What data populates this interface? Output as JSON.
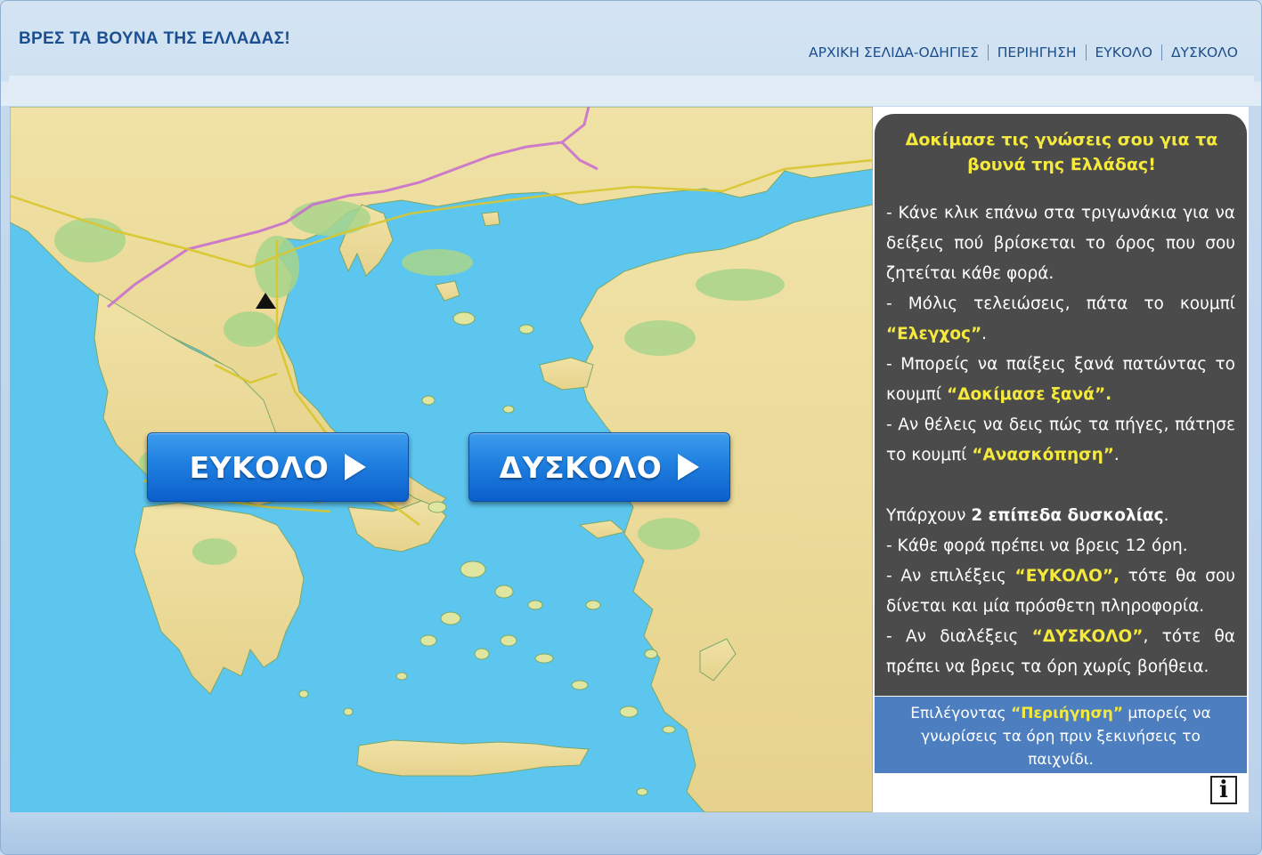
{
  "app": {
    "title": "ΒΡΕΣ ΤΑ ΒΟΥΝΑ ΤΗΣ ΕΛΛΑΔΑΣ!"
  },
  "nav": {
    "items": [
      {
        "label": "ΑΡΧΙΚΗ ΣΕΛΙΔΑ-ΟΔΗΓΙΕΣ"
      },
      {
        "label": "ΠΕΡΙΗΓΗΣΗ"
      },
      {
        "label": "ΕΥΚΟΛΟ"
      },
      {
        "label": "ΔΥΣΚΟΛΟ"
      }
    ]
  },
  "map": {
    "easy_button": {
      "label": "ΕΥΚΟΛΟ",
      "icon": "play-icon"
    },
    "hard_button": {
      "label": "ΔΥΣΚΟΛΟ",
      "icon": "play-icon"
    },
    "marker_icon": "triangle-marker-icon",
    "colors": {
      "sea": "#5cc6ef",
      "land": "#e9dca0",
      "lowland": "#a9d58b",
      "border": "#c56ad0",
      "road": "#d8c52c"
    }
  },
  "panel": {
    "title": "Δοκίμασε τις γνώσεις σου για τα βουνά της Ελλάδας!",
    "line1": "- Κάνε κλικ επάνω στα τριγωνάκια για να δείξεις πού βρίσκεται το όρος που σου ζητείται κάθε φορά.",
    "line2_pre": "- Μόλις τελειώσεις, πάτα το κουμπί ",
    "line2_hl": "“Ελεγχος”",
    "line2_post": ".",
    "line3_pre": "- Μπορείς να παίξεις ξανά πατώντας το κουμπί ",
    "line3_hl": "“Δοκίμασε ξανά”.",
    "line4_pre": "- Αν θέλεις να δεις πώς τα πήγες, πάτησε το κουμπί ",
    "line4_hl": "“Ανασκόπηση”",
    "line4_post": ".",
    "line5_pre": "Υπάρχουν ",
    "line5_bold": "2 επίπεδα δυσκολίας",
    "line5_post": ".",
    "line6": "- Κάθε φορά πρέπει να βρεις 12 όρη.",
    "line7_pre": "- Αν επιλέξεις ",
    "line7_hl": "“ΕΥΚΟΛΟ”,",
    "line7_post": " τότε θα σου δίνεται και μία πρόσθετη πληροφορία.",
    "line8_pre": "- Αν διαλέξεις ",
    "line8_hl": "“ΔΥΣΚΟΛΟ”",
    "line8_post": ", τότε θα πρέπει να βρεις τα όρη χωρίς βοήθεια.",
    "footer_pre": "Επιλέγοντας ",
    "footer_hl": "“Περιήγηση”",
    "footer_post": " μπορείς να γνωρίσεις τα όρη πριν ξεκινήσεις το παιχνίδι.",
    "info_label": "i"
  }
}
